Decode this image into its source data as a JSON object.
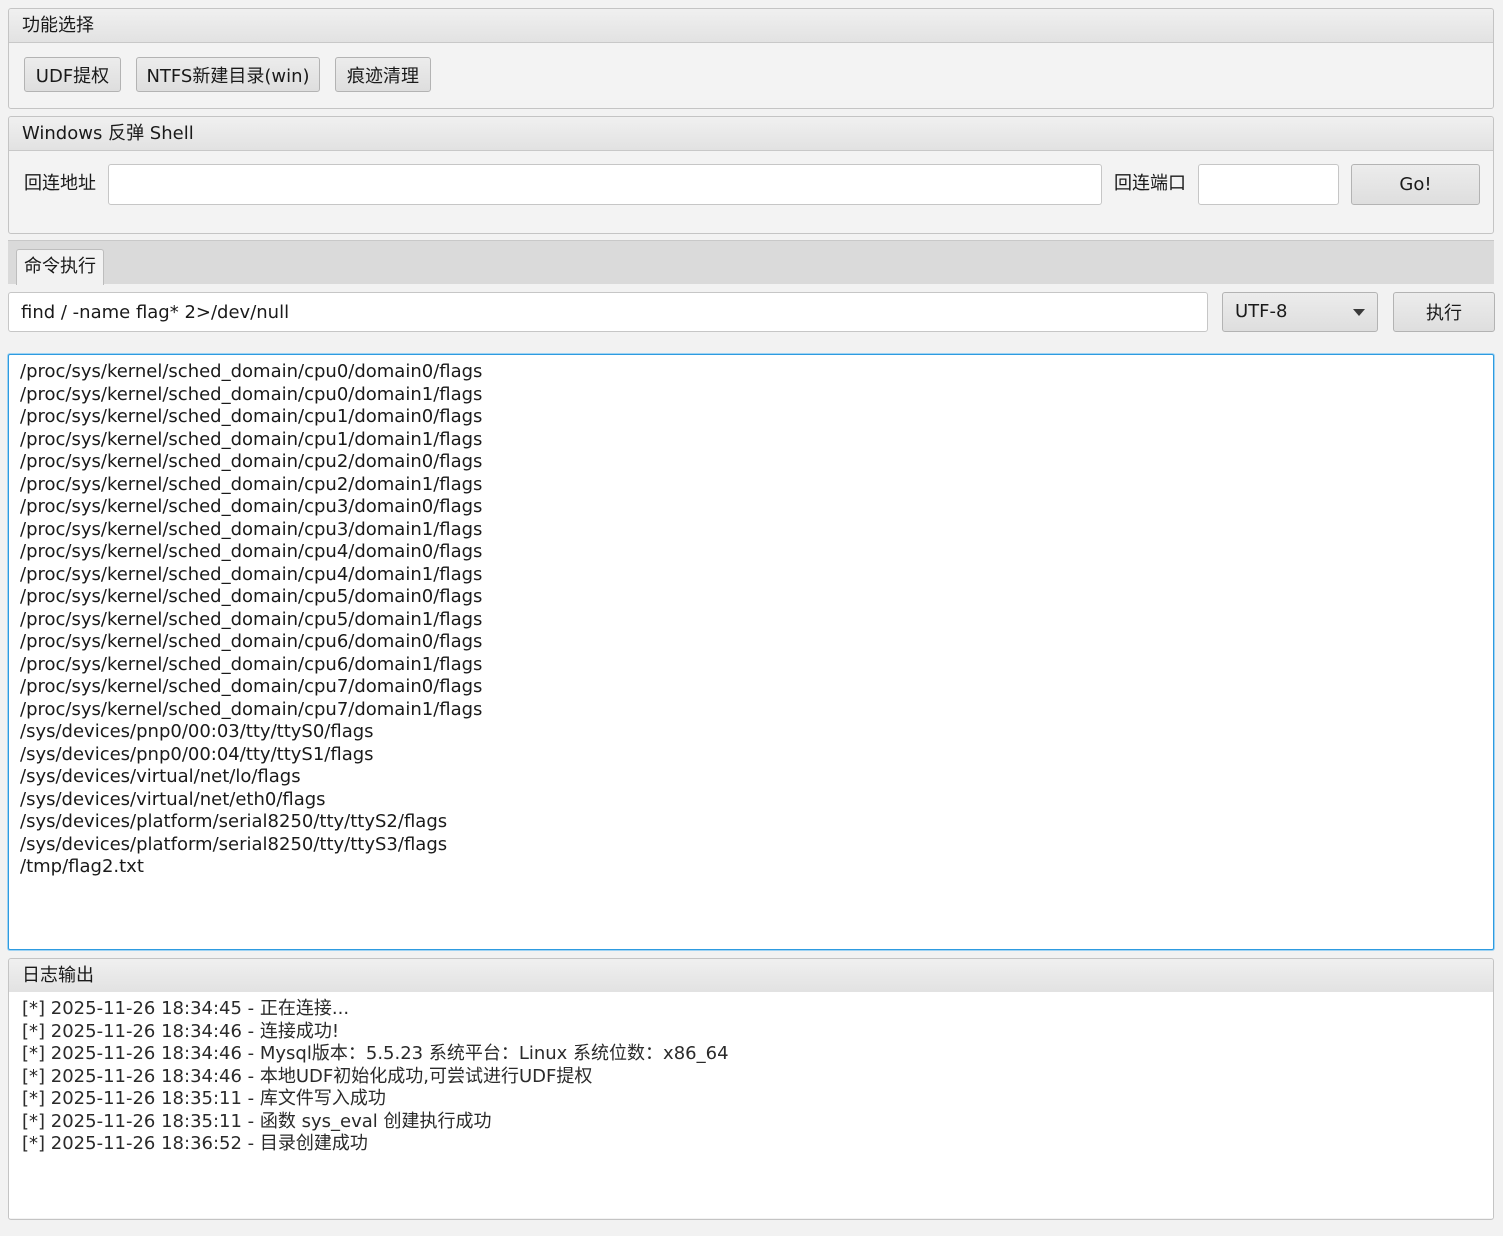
{
  "function_panel": {
    "title": "功能选择",
    "buttons": {
      "udf": "UDF提权",
      "ntfs": "NTFS新建目录(win)",
      "clean": "痕迹清理"
    }
  },
  "reverse_shell": {
    "title": "Windows 反弹 Shell",
    "address_label": "回连地址",
    "address_value": "",
    "port_label": "回连端口",
    "port_value": "",
    "go_label": "Go!"
  },
  "command": {
    "tab_label": "命令执行",
    "input_value": "find / -name flag* 2>/dev/null",
    "encoding": "UTF-8",
    "execute_label": "执行"
  },
  "result_lines": [
    "/proc/sys/kernel/sched_domain/cpu0/domain0/flags",
    "/proc/sys/kernel/sched_domain/cpu0/domain1/flags",
    "/proc/sys/kernel/sched_domain/cpu1/domain0/flags",
    "/proc/sys/kernel/sched_domain/cpu1/domain1/flags",
    "/proc/sys/kernel/sched_domain/cpu2/domain0/flags",
    "/proc/sys/kernel/sched_domain/cpu2/domain1/flags",
    "/proc/sys/kernel/sched_domain/cpu3/domain0/flags",
    "/proc/sys/kernel/sched_domain/cpu3/domain1/flags",
    "/proc/sys/kernel/sched_domain/cpu4/domain0/flags",
    "/proc/sys/kernel/sched_domain/cpu4/domain1/flags",
    "/proc/sys/kernel/sched_domain/cpu5/domain0/flags",
    "/proc/sys/kernel/sched_domain/cpu5/domain1/flags",
    "/proc/sys/kernel/sched_domain/cpu6/domain0/flags",
    "/proc/sys/kernel/sched_domain/cpu6/domain1/flags",
    "/proc/sys/kernel/sched_domain/cpu7/domain0/flags",
    "/proc/sys/kernel/sched_domain/cpu7/domain1/flags",
    "/sys/devices/pnp0/00:03/tty/ttyS0/flags",
    "/sys/devices/pnp0/00:04/tty/ttyS1/flags",
    "/sys/devices/virtual/net/lo/flags",
    "/sys/devices/virtual/net/eth0/flags",
    "/sys/devices/platform/serial8250/tty/ttyS2/flags",
    "/sys/devices/platform/serial8250/tty/ttyS3/flags",
    "/tmp/flag2.txt"
  ],
  "log": {
    "title": "日志输出",
    "lines": [
      "[*] 2025-11-26 18:34:45 - 正在连接...",
      "[*] 2025-11-26 18:34:46 - 连接成功!",
      "[*] 2025-11-26 18:34:46 - Mysql版本：5.5.23 系统平台：Linux 系统位数：x86_64",
      "[*] 2025-11-26 18:34:46 - 本地UDF初始化成功,可尝试进行UDF提权",
      "[*] 2025-11-26 18:35:11 - 库文件写入成功",
      "[*] 2025-11-26 18:35:11 - 函数 sys_eval 创建执行成功",
      "[*] 2025-11-26 18:36:52 - 目录创建成功"
    ]
  }
}
